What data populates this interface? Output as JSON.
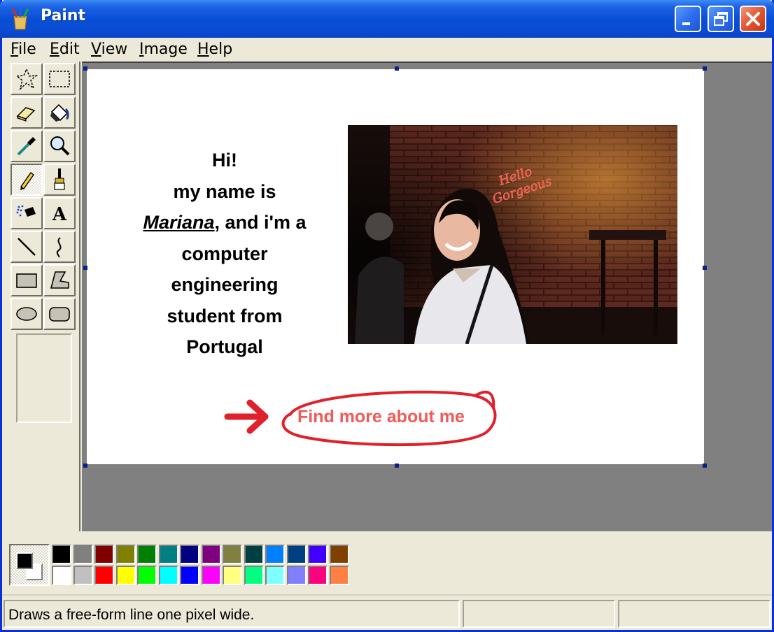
{
  "window": {
    "title": "Paint"
  },
  "menu": {
    "items": [
      {
        "label": "File",
        "accel": "F",
        "rest": "ile"
      },
      {
        "label": "Edit",
        "accel": "E",
        "rest": "dit"
      },
      {
        "label": "View",
        "accel": "V",
        "rest": "iew"
      },
      {
        "label": "Image",
        "accel": "I",
        "rest": "mage"
      },
      {
        "label": "Help",
        "accel": "H",
        "rest": "elp"
      }
    ]
  },
  "tools": [
    {
      "name": "free-form-select",
      "icon": "free-form-select-icon"
    },
    {
      "name": "select",
      "icon": "rect-select-icon"
    },
    {
      "name": "eraser",
      "icon": "eraser-icon"
    },
    {
      "name": "fill-with-color",
      "icon": "paint-bucket-icon"
    },
    {
      "name": "pick-color",
      "icon": "eyedropper-icon"
    },
    {
      "name": "magnifier",
      "icon": "magnifier-icon"
    },
    {
      "name": "pencil",
      "icon": "pencil-icon",
      "active": true
    },
    {
      "name": "brush",
      "icon": "brush-icon"
    },
    {
      "name": "airbrush",
      "icon": "airbrush-icon"
    },
    {
      "name": "text",
      "icon": "text-icon"
    },
    {
      "name": "line",
      "icon": "line-icon"
    },
    {
      "name": "curve",
      "icon": "curve-icon"
    },
    {
      "name": "rectangle",
      "icon": "rectangle-icon"
    },
    {
      "name": "polygon",
      "icon": "polygon-icon"
    },
    {
      "name": "ellipse",
      "icon": "ellipse-icon"
    },
    {
      "name": "rounded-rectangle",
      "icon": "rounded-rectangle-icon"
    }
  ],
  "canvas": {
    "intro_lines": {
      "line1": "Hi!",
      "line2": "my name is",
      "name": "Mariana",
      "line3_rest": ", and i'm a",
      "line4": "computer",
      "line5": "engineering",
      "line6": "student from",
      "line7": "Portugal"
    },
    "neon_sign": {
      "line1": "Hello",
      "line2": "Gorgeous"
    },
    "cta_label": "Find more about me",
    "accent_color": "#f05a5a",
    "marker_color": "#e0202a"
  },
  "palette": {
    "foreground": "#000000",
    "background": "#ffffff",
    "colors": [
      "#000000",
      "#808080",
      "#800000",
      "#808000",
      "#008000",
      "#008080",
      "#000080",
      "#800080",
      "#808040",
      "#004040",
      "#0080ff",
      "#004080",
      "#4000ff",
      "#804000",
      "#ffffff",
      "#c0c0c0",
      "#ff0000",
      "#ffff00",
      "#00ff00",
      "#00ffff",
      "#0000ff",
      "#ff00ff",
      "#ffff80",
      "#00ff80",
      "#80ffff",
      "#8080ff",
      "#ff0080",
      "#ff8040"
    ]
  },
  "status": {
    "message": "Draws a free-form line one pixel wide.",
    "cell2": "",
    "cell3": ""
  }
}
